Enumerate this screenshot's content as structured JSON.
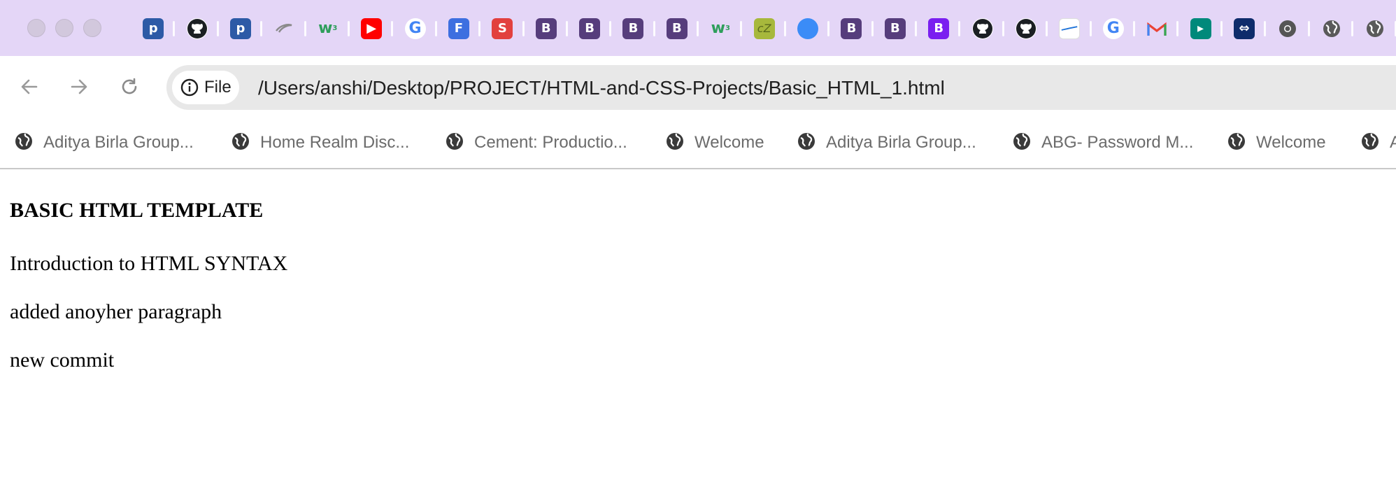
{
  "browser": {
    "tab_favicons": [
      {
        "icon": "pcloudy-icon",
        "glyph": "p",
        "bg": "#2d5aa6",
        "round": false
      },
      {
        "icon": "github-icon",
        "glyph": "gh",
        "bg": "#ffffff",
        "round": true
      },
      {
        "icon": "pcloudy-icon",
        "glyph": "p",
        "bg": "#2d5aa6",
        "round": false
      },
      {
        "icon": "feather-icon",
        "glyph": "~",
        "bg": "transparent",
        "round": false
      },
      {
        "icon": "w3schools-icon",
        "glyph": "w",
        "bg": "transparent",
        "round": false
      },
      {
        "icon": "youtube-icon",
        "glyph": "▶",
        "bg": "#ff0000",
        "round": false
      },
      {
        "icon": "google-icon",
        "glyph": "G",
        "bg": "#ffffff",
        "round": true
      },
      {
        "icon": "forms-icon",
        "glyph": "F",
        "bg": "#3d6fe0",
        "round": false
      },
      {
        "icon": "scrum-icon",
        "glyph": "S",
        "bg": "#e2403e",
        "round": false
      },
      {
        "icon": "bootstrap-icon",
        "glyph": "B",
        "bg": "#563d7c",
        "round": false
      },
      {
        "icon": "bootstrap-icon",
        "glyph": "B",
        "bg": "#563d7c",
        "round": false
      },
      {
        "icon": "bootstrap-icon",
        "glyph": "B",
        "bg": "#563d7c",
        "round": false
      },
      {
        "icon": "bootstrap-icon",
        "glyph": "B",
        "bg": "#563d7c",
        "round": false
      },
      {
        "icon": "w3schools-icon",
        "glyph": "w",
        "bg": "transparent",
        "round": false
      },
      {
        "icon": "cz-icon",
        "glyph": "cZ",
        "bg": "#a7b83c",
        "round": false
      },
      {
        "icon": "blue-dot-icon",
        "glyph": "",
        "bg": "#3b8cf7",
        "round": true
      },
      {
        "icon": "bootstrap-icon",
        "glyph": "B",
        "bg": "#563d7c",
        "round": false
      },
      {
        "icon": "bootstrap-icon",
        "glyph": "B",
        "bg": "#563d7c",
        "round": false
      },
      {
        "icon": "bootstrap-icon",
        "glyph": "B",
        "bg": "#7a1ff0",
        "round": false
      },
      {
        "icon": "github-icon",
        "glyph": "gh",
        "bg": "#ffffff",
        "round": true
      },
      {
        "icon": "github-icon",
        "glyph": "gh",
        "bg": "#ffffff",
        "round": true
      },
      {
        "icon": "wave-icon",
        "glyph": "~",
        "bg": "#ffffff",
        "round": false
      },
      {
        "icon": "google-icon",
        "glyph": "G",
        "bg": "#ffffff",
        "round": true
      },
      {
        "icon": "gmail-icon",
        "glyph": "M",
        "bg": "transparent",
        "round": false
      },
      {
        "icon": "google-meet-icon",
        "glyph": "▸",
        "bg": "#00897b",
        "round": false
      },
      {
        "icon": "teamviewer-icon",
        "glyph": "⇔",
        "bg": "#0e2c6b",
        "round": false
      },
      {
        "icon": "chrome-icon",
        "glyph": "◎",
        "bg": "transparent",
        "round": true
      },
      {
        "icon": "globe-icon",
        "glyph": "",
        "bg": "transparent",
        "round": true
      },
      {
        "icon": "globe-icon",
        "glyph": "",
        "bg": "transparent",
        "round": true
      },
      {
        "icon": "globe-icon",
        "glyph": "",
        "bg": "transparent",
        "round": true
      }
    ],
    "omnibox": {
      "chip_label": "File",
      "url": "/Users/anshi/Desktop/PROJECT/HTML-and-CSS-Projects/Basic_HTML_1.html"
    },
    "bookmarks": [
      {
        "label": "Aditya Birla Group..."
      },
      {
        "label": "Home Realm Disc..."
      },
      {
        "label": "Cement: Productio..."
      },
      {
        "label": "Welcome"
      },
      {
        "label": "Aditya Birla Group..."
      },
      {
        "label": "ABG- Password M..."
      },
      {
        "label": "Welcome"
      },
      {
        "label": "A"
      }
    ],
    "colors": {
      "tabstrip": "#e4d6f7",
      "omnibox": "#e8e8e8",
      "bookmark_text": "#6b6b6b"
    }
  },
  "page": {
    "heading": "BASIC HTML TEMPLATE",
    "paragraphs": [
      "Introduction to HTML SYNTAX",
      "added anoyher paragraph",
      "new commit"
    ]
  }
}
